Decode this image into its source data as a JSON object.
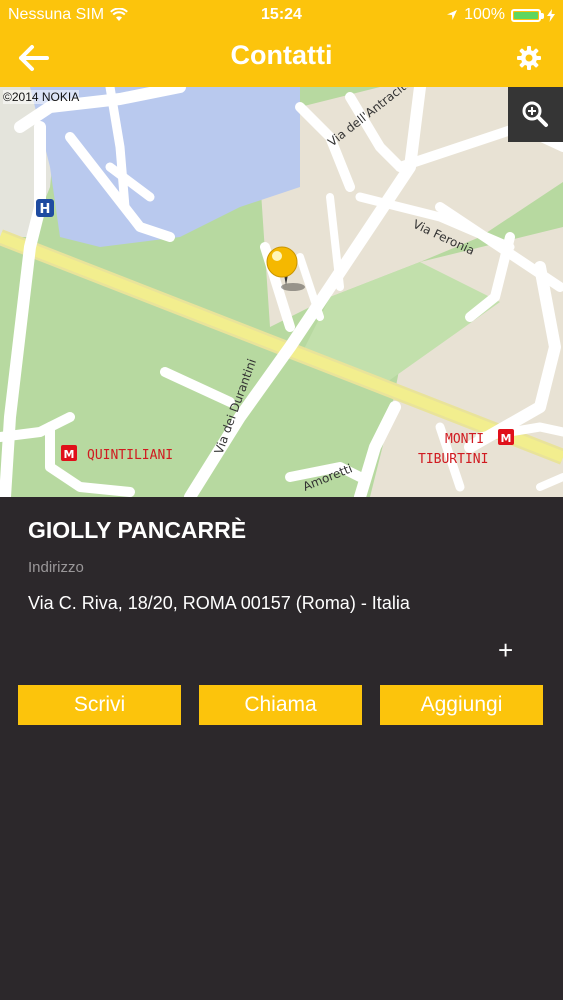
{
  "status_bar": {
    "carrier": "Nessuna SIM",
    "time": "15:24",
    "battery": "100%"
  },
  "header": {
    "title": "Contatti",
    "back_icon": "arrow-left-icon",
    "settings_icon": "gear-icon"
  },
  "map": {
    "copyright": "©2014 NOKIA",
    "labels": {
      "via_antracite": "Via dell'Antracite",
      "via_feronia": "Via Feronia",
      "via_durantini": "Via dei Durantini",
      "quintiliani": "QUINTILIANI",
      "monti_line1": "MONTI",
      "monti_line2": "TIBURTINI",
      "amoretti": "Amoretti",
      "hospital": "H",
      "metro": "M"
    },
    "zoom_icon": "zoom-in-icon",
    "pin_icon": "map-pin-icon"
  },
  "contact": {
    "name": "GIOLLY PANCARRÈ",
    "address_label": "Indirizzo",
    "address": "Via C. Riva, 18/20, ROMA 00157 (Roma) - Italia",
    "more_label": "+"
  },
  "actions": {
    "write": "Scrivi",
    "call": "Chiama",
    "add": "Aggiungi"
  },
  "colors": {
    "accent": "#fcc40c",
    "background": "#2c282b",
    "map_park": "#b7d9a0",
    "map_water": "#b9c9ee",
    "map_urban": "#e8e2d4",
    "metro": "#e0101a"
  }
}
